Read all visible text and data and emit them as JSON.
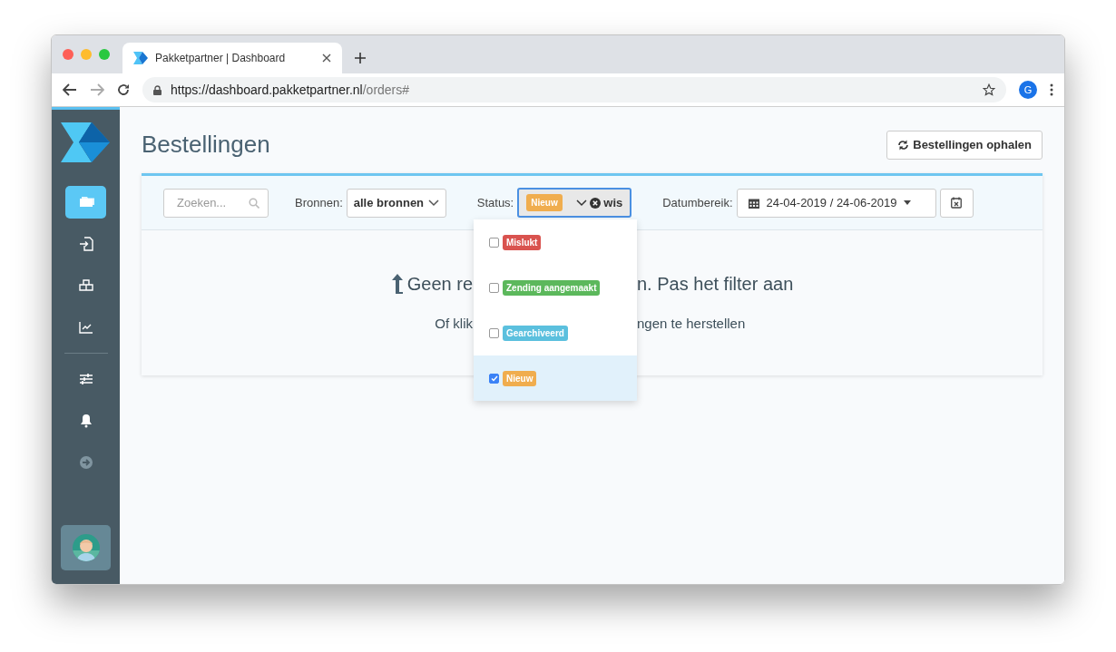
{
  "browser": {
    "tab_title": "Pakketpartner | Dashboard",
    "url_host": "https://dashboard.pakketpartner.nl",
    "url_path": "/orders#",
    "profile": "G"
  },
  "sidebar": {
    "items": [
      {
        "kind": "orders",
        "selected": true
      },
      {
        "kind": "import",
        "selected": false
      },
      {
        "kind": "boxes",
        "selected": false
      },
      {
        "kind": "chart",
        "selected": false
      }
    ],
    "bottom_items": [
      {
        "kind": "sliders",
        "selected": false
      },
      {
        "kind": "bell",
        "selected": false
      },
      {
        "kind": "arrow",
        "selected": false
      }
    ]
  },
  "page": {
    "title": "Bestellingen",
    "fetch_button": "Bestellingen ophalen"
  },
  "filters": {
    "search": {
      "placeholder": "Zoeken..."
    },
    "sources": {
      "label": "Bronnen:",
      "value": "alle bronnen"
    },
    "status": {
      "label": "Status:",
      "selected_tag": {
        "label": "Nieuw",
        "color": "#f0ad4e"
      },
      "clear": "wis",
      "expanded": true,
      "options": [
        {
          "label": "Mislukt",
          "color": "#d9534f",
          "checked": false,
          "selected": false
        },
        {
          "label": "Zending aangemaakt",
          "color": "#5cb85c",
          "checked": false,
          "selected": false
        },
        {
          "label": "Gearchiveerd",
          "color": "#5bc0de",
          "checked": false,
          "selected": false
        },
        {
          "label": "Nieuw",
          "color": "#f0ad4e",
          "checked": true,
          "selected": true
        }
      ]
    },
    "date_range": {
      "label": "Datumbereik:",
      "value": "24-04-2019 / 24-06-2019"
    }
  },
  "empty_state": {
    "headline_left": "Geen re",
    "headline_right": "n. Pas het filter aan",
    "hint_left": "Of klik",
    "hint_right": "ngen te herstellen"
  }
}
